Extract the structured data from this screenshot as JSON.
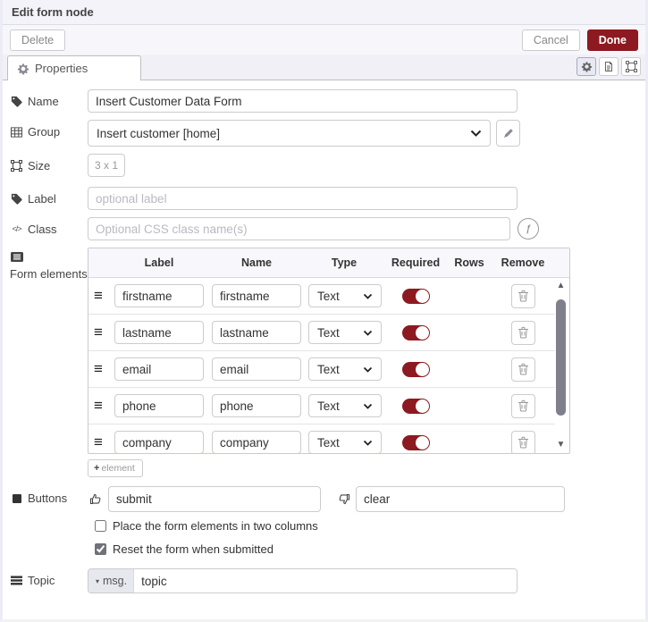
{
  "colors": {
    "accent-red": "#8c1a20",
    "titlebar-bg": "#f3f3f9",
    "btnrow-bg": "#f7f7fb",
    "tabbar-bg": "#f0f0f6",
    "table-head-bg": "#f7f7fc"
  },
  "dialog": {
    "title": "Edit form node",
    "delete_label": "Delete",
    "cancel_label": "Cancel",
    "done_label": "Done",
    "tab_properties": "Properties"
  },
  "fields": {
    "name": {
      "label": "Name",
      "value": "Insert Customer Data Form"
    },
    "group": {
      "label": "Group",
      "value": "Insert customer [home]"
    },
    "size": {
      "label": "Size",
      "value": "3 x 1"
    },
    "label_field": {
      "label": "Label",
      "placeholder": "optional label"
    },
    "css_class": {
      "label": "Class",
      "placeholder": "Optional CSS class name(s)"
    },
    "form_elements": {
      "label": "Form elements",
      "columns": [
        "Label",
        "Name",
        "Type",
        "Required",
        "Rows",
        "Remove"
      ],
      "rows": [
        {
          "label": "firstname",
          "name": "firstname",
          "type": "Text",
          "required": true
        },
        {
          "label": "lastname",
          "name": "lastname",
          "type": "Text",
          "required": true
        },
        {
          "label": "email",
          "name": "email",
          "type": "Text",
          "required": true
        },
        {
          "label": "phone",
          "name": "phone",
          "type": "Text",
          "required": true
        },
        {
          "label": "company",
          "name": "company",
          "type": "Text",
          "required": true
        }
      ],
      "add_button_label": "element"
    },
    "buttons": {
      "label": "Buttons",
      "submit_value": "submit",
      "clear_value": "clear"
    },
    "two_columns_checkbox": {
      "label": "Place the form elements in two columns",
      "checked": false
    },
    "reset_checkbox": {
      "label": "Reset the form when submitted",
      "checked": true
    },
    "topic": {
      "label": "Topic",
      "prefix": "msg.",
      "value": "topic"
    }
  }
}
